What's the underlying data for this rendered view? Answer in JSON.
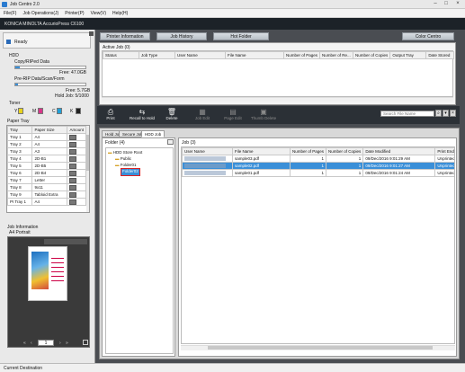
{
  "window": {
    "title": "Job Centro 2.0"
  },
  "menu": [
    "File(F)",
    "Job Operations(J)",
    "Printer(P)",
    "View(V)",
    "Help(H)"
  ],
  "device": {
    "name": "KONICA MINOLTA AccurioPress C6100",
    "status": "Ready"
  },
  "hdd": {
    "title": "HDD",
    "copy_label": "Copy/RIPed Data",
    "copy_free": "Free: 47.0GB",
    "preripped_label": "Pre-RIP Data/Scan/Form",
    "preripped_free": "Free: 5.7GB",
    "hold_job": "Hold Job: 5/1000"
  },
  "toner": {
    "title": "Toner",
    "labels": [
      "Y",
      "M",
      "C",
      "K"
    ],
    "colors": [
      "#e8d21c",
      "#d8358a",
      "#1fa0d8",
      "#222222"
    ]
  },
  "paper_tray": {
    "title": "Paper Tray",
    "headers": [
      "Tray",
      "Paper Size",
      "Amount"
    ],
    "rows": [
      [
        "Tray 1",
        "A4"
      ],
      [
        "Tray 2",
        "A4"
      ],
      [
        "Tray 3",
        "A3"
      ],
      [
        "Tray 4",
        "2D-B1"
      ],
      [
        "Tray 5",
        "2D-B5"
      ],
      [
        "Tray 6",
        "2D-B4"
      ],
      [
        "Tray 7",
        "Letter"
      ],
      [
        "Tray 8",
        "9x11"
      ],
      [
        "Tray 9",
        "Tabloid Extra"
      ],
      [
        "PI Tray 1",
        "A4"
      ]
    ]
  },
  "job_info": {
    "title": "Job Information",
    "orientation": "A4 Portrait",
    "page_num": "1"
  },
  "nav": {
    "printer_info": "Printer Information",
    "job_history": "Job History",
    "hot_folder": "Hot Folder",
    "color_centro": "Color Centro"
  },
  "active_job": {
    "title": "Active Job (0)",
    "headers": [
      "Status",
      "Job Type",
      "User Name",
      "File Name",
      "Number of Pages",
      "Number of Re...",
      "Number of Copies",
      "Output Tray",
      "Date Stored"
    ]
  },
  "toolbar": {
    "print": "Print",
    "recall": "Recall to Hold",
    "delete": "Delete",
    "job_edit": "Job Edit",
    "page_edit": "Page Edit",
    "thumb": "Thumb Delete",
    "search_placeholder": "Search File Name"
  },
  "tabs": [
    "Hold Job",
    "Secure Job",
    "HDD Job"
  ],
  "folder": {
    "title": "Folder (4)",
    "tree": [
      "HDD Store Root",
      "Public",
      "Folder01",
      "Folder02"
    ]
  },
  "job": {
    "title": "Job (3)",
    "headers": [
      "User Name",
      "File Name",
      "Number of Pages",
      "Number of Copies",
      "Date Modified",
      "Print End"
    ],
    "rows": [
      {
        "user": "",
        "file": "sample03.pdf",
        "pages": "1",
        "copies": "1",
        "date": "09/Dec/2016 9:01:29 AM",
        "end": "Unprinted"
      },
      {
        "user": "",
        "file": "sample02.pdf",
        "pages": "1",
        "copies": "1",
        "date": "09/Dec/2016 9:01:27 AM",
        "end": "Unprinted"
      },
      {
        "user": "",
        "file": "sample01.pdf",
        "pages": "1",
        "copies": "1",
        "date": "09/Dec/2016 9:01:24 AM",
        "end": "Unprinted"
      }
    ]
  },
  "statusbar": {
    "text": "Current Destination"
  }
}
